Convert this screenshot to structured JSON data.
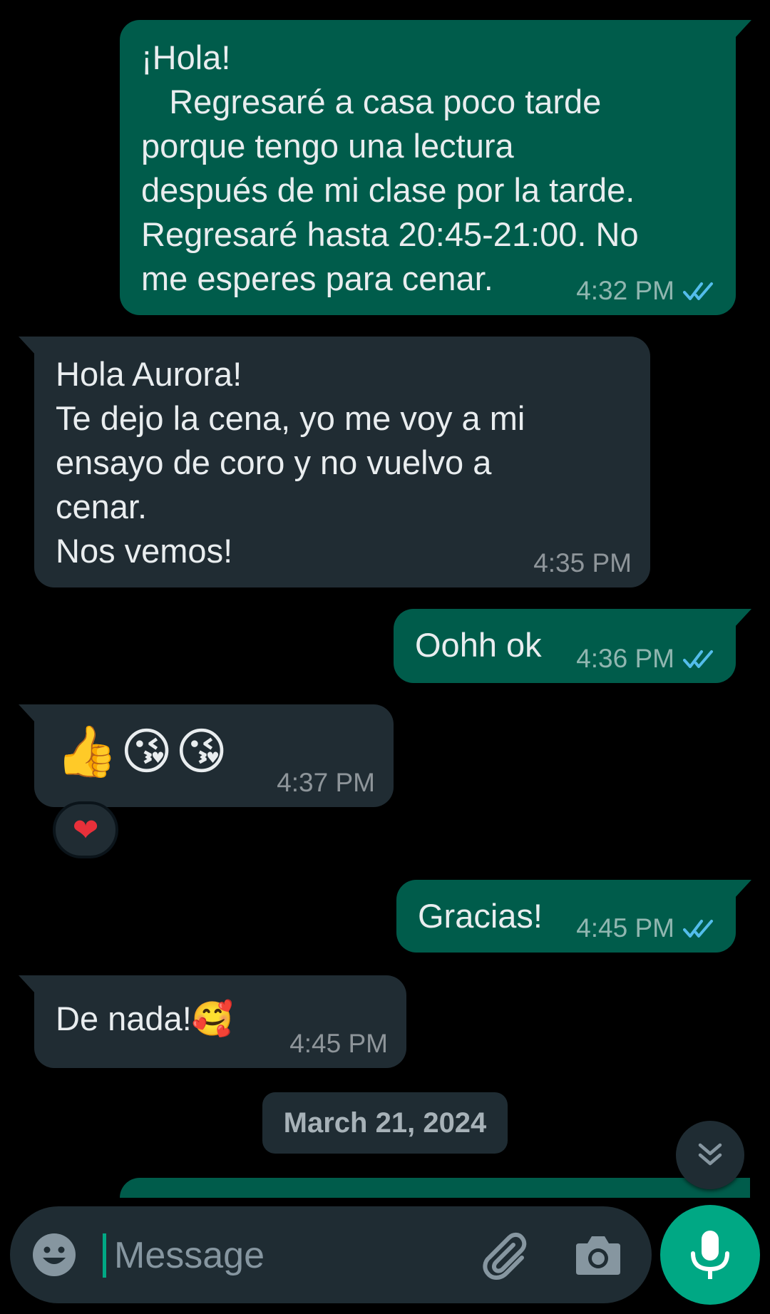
{
  "messages": [
    {
      "direction": "outgoing",
      "text": "¡Hola!\n   Regresaré a casa poco tarde\nporque tengo una lectura\ndespués de mi clase por la tarde.\nRegresaré hasta 20:45-21:00. No\nme esperes para cenar.",
      "time": "4:32 PM",
      "status": "read"
    },
    {
      "direction": "incoming",
      "text": "Hola Aurora!\nTe dejo la cena, yo me voy a mi\nensayo de coro y no vuelvo a\ncenar.\nNos vemos!",
      "time": "4:35 PM"
    },
    {
      "direction": "outgoing",
      "text": "Oohh ok",
      "time": "4:36 PM",
      "status": "read"
    },
    {
      "direction": "incoming",
      "text": "👍😘😘",
      "time": "4:37 PM",
      "reaction": "❤"
    },
    {
      "direction": "outgoing",
      "text": "Gracias!",
      "time": "4:45 PM",
      "status": "read"
    },
    {
      "direction": "incoming",
      "text": "De nada!🥰",
      "time": "4:45 PM"
    }
  ],
  "date_separator": "March 21, 2024",
  "composer": {
    "placeholder": "Message"
  },
  "icons": {
    "emoji": "emoji-icon",
    "attach": "paperclip-icon",
    "camera": "camera-icon",
    "mic": "microphone-icon",
    "scroll": "double-chevron-down-icon",
    "read": "double-check-icon"
  },
  "colors": {
    "outgoing_bubble": "#005c4b",
    "incoming_bubble": "#202c33",
    "accent": "#00a884",
    "read_ticks": "#53bdeb"
  }
}
